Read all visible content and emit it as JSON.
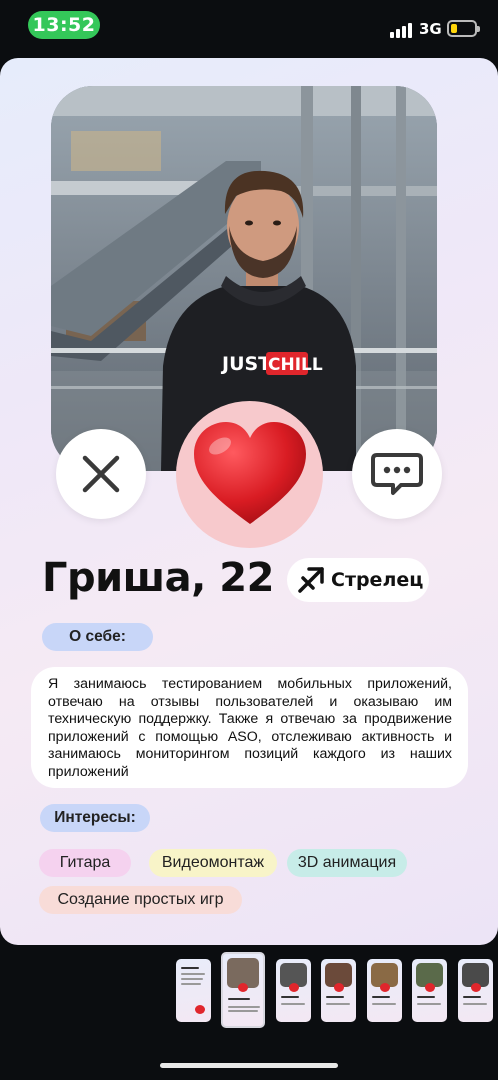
{
  "status_bar": {
    "time": "13:52",
    "network": "3G",
    "battery_level": 0.25
  },
  "profile": {
    "name_age": "Гриша, 22",
    "zodiac": {
      "label": "Стрелец",
      "icon": "sagittarius-icon"
    },
    "photo": {
      "shirt_text_black": "JUST",
      "shirt_text_red": "CHILL"
    },
    "about_label": "О себе:",
    "bio": "Я занимаюсь тестированием мобильных приложений, отвечаю на отзывы пользователей и оказываю им техническую поддержку. Также я отвечаю за продвижение приложений с помощью ASO, отслеживаю активность и занимаюсь мониторингом позиций каждого из наших приложений",
    "interests_label": "Интересы:",
    "interests": [
      {
        "label": "Гитара",
        "color": "#f5d2ef"
      },
      {
        "label": "Видеомонтаж",
        "color": "#f8f4c8"
      },
      {
        "label": "3D анимация",
        "color": "#c7ece8"
      },
      {
        "label": "Создание простых игр",
        "color": "#f8dcd8"
      }
    ]
  },
  "actions": {
    "dislike_icon": "close-icon",
    "like_icon": "heart-icon",
    "message_icon": "chat-icon"
  },
  "colors": {
    "accent_red": "#e0262c",
    "chip_blue": "#c8d6f8",
    "status_green": "#34c759"
  }
}
